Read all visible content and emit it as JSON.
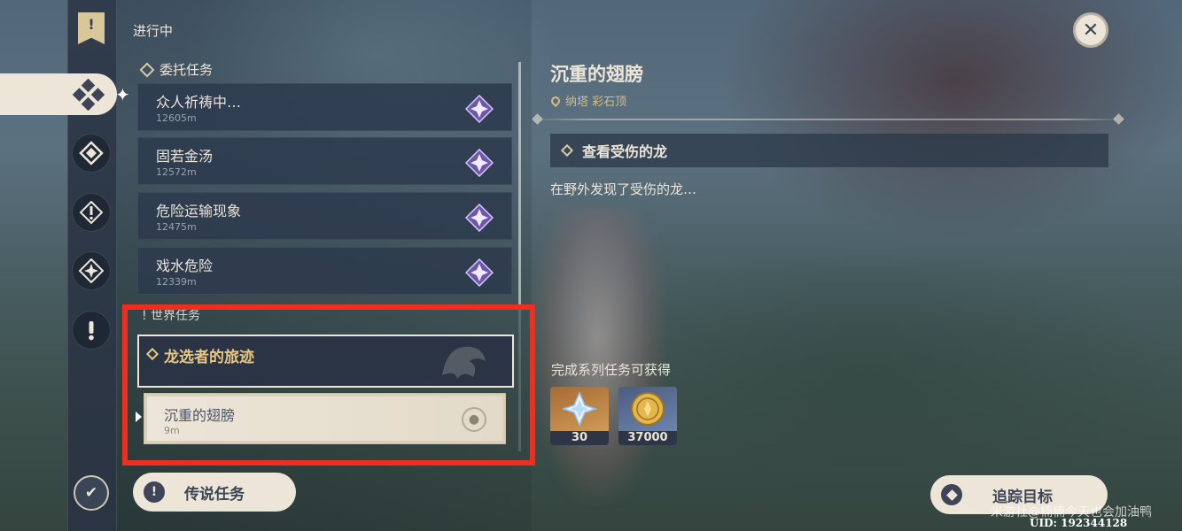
{
  "header": {
    "in_progress_label": "进行中"
  },
  "commission_section": {
    "label": "委托任务",
    "quests": [
      {
        "title": "众人祈祷中…",
        "distance": "12605m",
        "icon": "purple-star-icon"
      },
      {
        "title": "固若金汤",
        "distance": "12572m",
        "icon": "purple-star-icon"
      },
      {
        "title": "危险运输现象",
        "distance": "12475m",
        "icon": "purple-star-icon"
      },
      {
        "title": "戏水危险",
        "distance": "12339m",
        "icon": "purple-star-icon"
      }
    ]
  },
  "world_section": {
    "label": "世界任务",
    "group_title": "龙选者的旅迹",
    "sub_quest": {
      "title": "沉重的翅膀",
      "distance": "9m",
      "icon": "location-pin-icon"
    }
  },
  "legend_button": {
    "label": "传说任务"
  },
  "detail": {
    "title": "沉重的翅膀",
    "location": "纳塔 彩石顶",
    "objective": "查看受伤的龙",
    "description": "在野外发现了受伤的龙…",
    "rewards_label": "完成系列任务可获得",
    "rewards": [
      {
        "name": "primogem-icon",
        "count": "30"
      },
      {
        "name": "mora-icon",
        "count": "37000"
      }
    ]
  },
  "track_button": {
    "label": "追踪目标"
  },
  "watermark": "米游社@楠楠今天也会加油鸭",
  "uid": "UID: 192344128",
  "colors": {
    "highlight": "#ee2e1e",
    "cream": "#ece5d8",
    "gold": "#e8c883"
  }
}
